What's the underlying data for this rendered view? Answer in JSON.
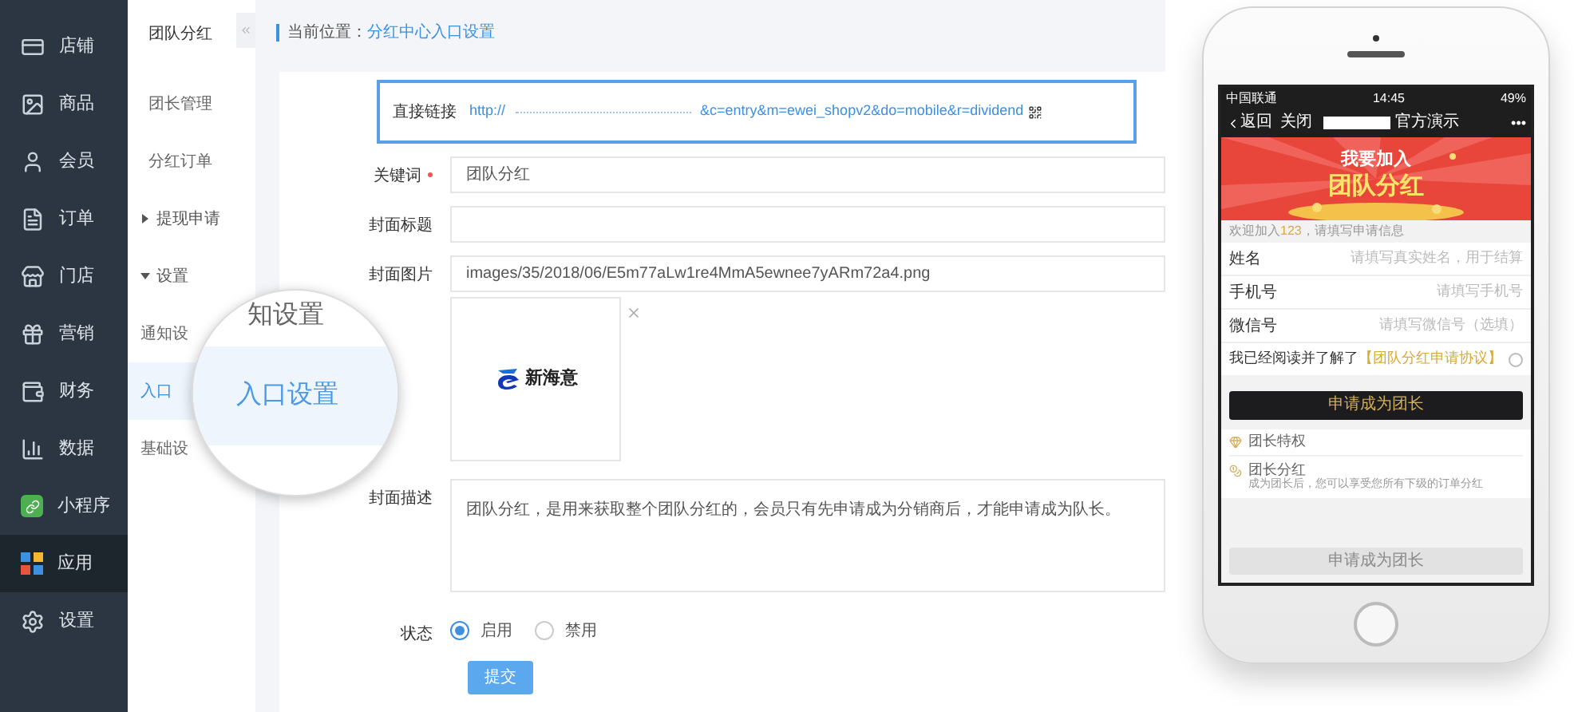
{
  "sidebar": {
    "items": [
      {
        "label": "店铺",
        "selected": false
      },
      {
        "label": "商品",
        "selected": false
      },
      {
        "label": "会员",
        "selected": false
      },
      {
        "label": "订单",
        "selected": false
      },
      {
        "label": "门店",
        "selected": false
      },
      {
        "label": "营销",
        "selected": false
      },
      {
        "label": "财务",
        "selected": false
      },
      {
        "label": "数据",
        "selected": false
      },
      {
        "label": "小程序",
        "selected": false
      },
      {
        "label": "应用",
        "selected": true
      },
      {
        "label": "设置",
        "selected": false
      }
    ]
  },
  "subnav": {
    "title": "团队分红",
    "items": [
      {
        "label": "团长管理",
        "kind": "link",
        "selected": false
      },
      {
        "label": "分红订单",
        "kind": "link",
        "selected": false
      },
      {
        "label": "提现申请",
        "kind": "group",
        "expanded": false
      },
      {
        "label": "设置",
        "kind": "group",
        "expanded": true,
        "children": [
          {
            "label": "通知设",
            "kind": "link",
            "selected": false
          },
          {
            "label": "入口",
            "kind": "link",
            "selected": true
          },
          {
            "label": "基础设",
            "kind": "link",
            "selected": false
          }
        ]
      }
    ]
  },
  "magnifier": {
    "items": [
      {
        "label": "知设置",
        "selected": false
      },
      {
        "label": "入口设置",
        "selected": true
      }
    ]
  },
  "breadcrumb": {
    "label": "当前位置：",
    "current": "分红中心入口设置"
  },
  "form": {
    "link": {
      "label": "直接链接",
      "prefix": "http://",
      "suffix": "&c=entry&m=ewei_shopv2&do=mobile&r=dividend"
    },
    "fields": [
      {
        "kind": "input",
        "label": "关键词",
        "required": true,
        "value": "团队分红"
      },
      {
        "kind": "input",
        "label": "封面标题"
      },
      {
        "kind": "image",
        "label": "封面图片",
        "value": "images/35/2018/06/E5m77aLw1re4MmA5ewnee7yARm72a4.png",
        "logo_text": "新海意"
      },
      {
        "kind": "textarea",
        "label": "封面描述",
        "value": "团队分红，是用来获取整个团队分红的，会员只有先申请成为分销商后，才能申请成为队长。"
      },
      {
        "kind": "radio",
        "label": "状态",
        "options": [
          {
            "label": "启用",
            "selected": true
          },
          {
            "label": "禁用",
            "selected": false
          }
        ]
      }
    ],
    "submit": "提交"
  },
  "phone": {
    "status_bar": {
      "carrier": "中国联通",
      "time": "14:45",
      "battery": "49%"
    },
    "nav": {
      "back": "返回",
      "close": "关闭",
      "title": "官方演示",
      "more": "•••"
    },
    "banner": {
      "line1": "我要加入",
      "line2": "团队分红"
    },
    "notice": {
      "before": "欢迎加入",
      "highlight": "123",
      "after": "，请填写申请信息"
    },
    "fields": [
      {
        "label": "姓名",
        "placeholder": "请填写真实姓名，用于结算"
      },
      {
        "label": "手机号",
        "placeholder": "请填写手机号"
      },
      {
        "label": "微信号",
        "placeholder": "请填写微信号（选填）"
      }
    ],
    "agreement": {
      "text": "我已经阅读并了解了",
      "link": "【团队分红申请协议】",
      "checked": false
    },
    "apply_button": "申请成为团长",
    "perks": [
      {
        "kind": "header",
        "title": "团长特权"
      },
      {
        "kind": "item",
        "title": "团长分红",
        "description": "成为团长后，您可以享受您所有下级的订单分红"
      }
    ],
    "bottom_button": {
      "label": "申请成为团长",
      "disabled": true
    }
  }
}
